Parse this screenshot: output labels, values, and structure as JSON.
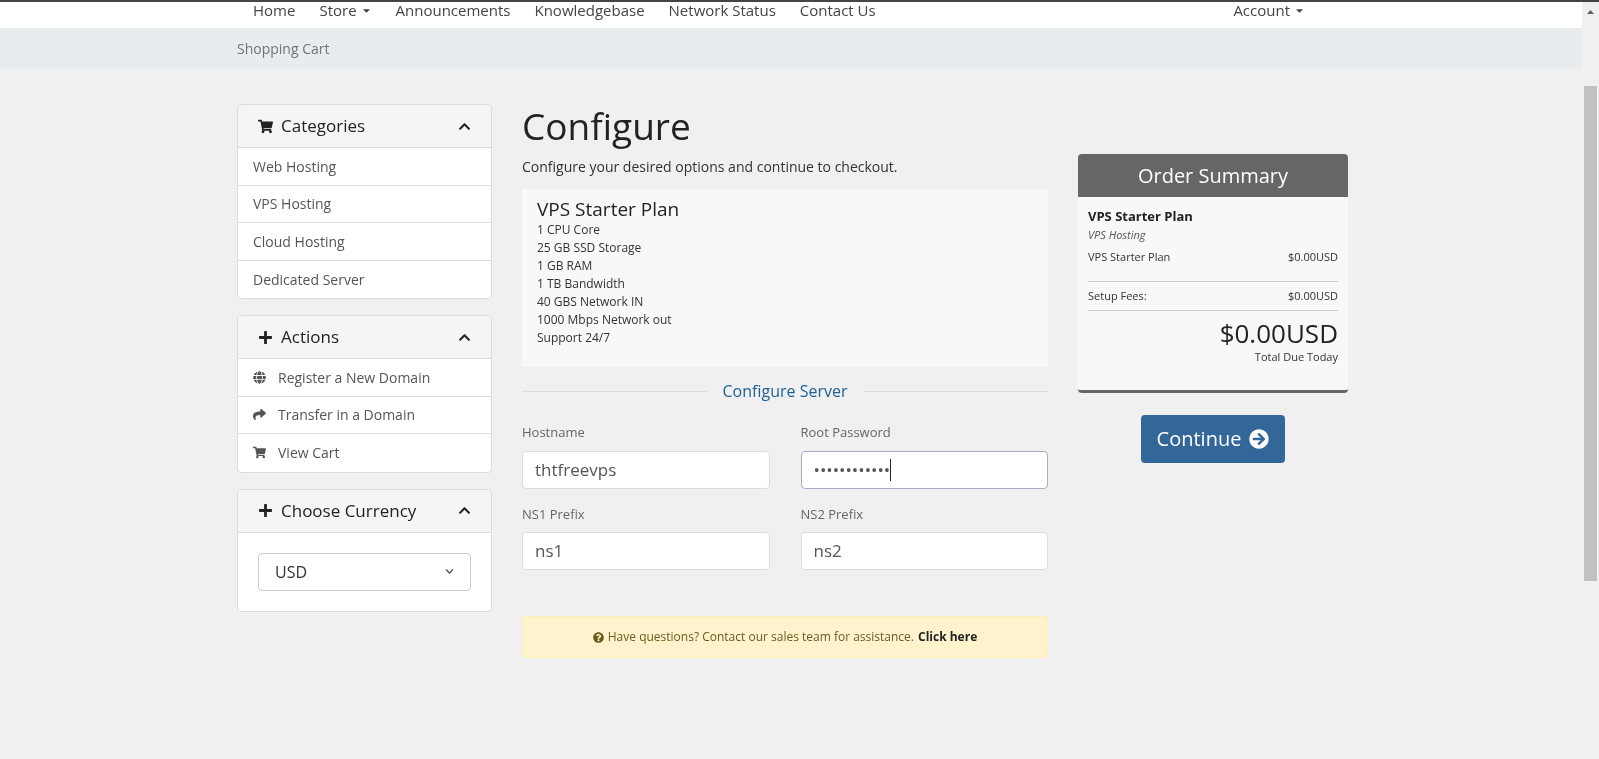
{
  "navbar": {
    "items": [
      {
        "label": "Home",
        "dropdown": false
      },
      {
        "label": "Store",
        "dropdown": true
      },
      {
        "label": "Announcements",
        "dropdown": false
      },
      {
        "label": "Knowledgebase",
        "dropdown": false
      },
      {
        "label": "Network Status",
        "dropdown": false
      },
      {
        "label": "Contact Us",
        "dropdown": false
      }
    ],
    "account": {
      "label": "Account",
      "dropdown": true
    }
  },
  "breadcrumb": "Shopping Cart",
  "sidebar": [
    {
      "title": "Categories",
      "expanded": true,
      "kind": "links",
      "items": [
        {
          "label": "Web Hosting",
          "kind": "plain"
        },
        {
          "label": "VPS Hosting",
          "kind": "plain"
        },
        {
          "label": "Cloud Hosting",
          "kind": "plain"
        },
        {
          "label": "Dedicated Server",
          "kind": "plain"
        }
      ]
    },
    {
      "title": "Actions",
      "expanded": true,
      "kind": "links",
      "items": [
        {
          "label": "Register a New Domain",
          "kind": "domain"
        },
        {
          "label": "Transfer in a Domain",
          "kind": "transfer"
        },
        {
          "label": "View Cart",
          "kind": "cart"
        }
      ]
    },
    {
      "title": "Choose Currency",
      "expanded": true,
      "kind": "select",
      "value": "USD"
    }
  ],
  "main": {
    "title": "Configure",
    "subtitle": "Configure your desired options and continue to checkout.",
    "product": {
      "name": "VPS Starter Plan",
      "features": [
        "1 CPU Core",
        "25 GB SSD Storage",
        "1 GB RAM",
        "1 TB Bandwidth",
        "40 GBS Network IN",
        "1000 Mbps Network out",
        "Support 24/7"
      ]
    },
    "section_title": "Configure Server",
    "fields": [
      {
        "label": "Hostname",
        "value": "thtfreevps",
        "focused": false
      },
      {
        "label": "Root Password",
        "value": "••••••••••••",
        "focused": true
      },
      {
        "label": "NS1 Prefix",
        "value": "ns1",
        "focused": false
      },
      {
        "label": "NS2 Prefix",
        "value": "ns2",
        "focused": false
      }
    ],
    "help": {
      "text": "Have questions? Contact our sales team for assistance.",
      "link": "Click here"
    }
  },
  "summary": {
    "title": "Order Summary",
    "product": "VPS Starter Plan",
    "group": "VPS Hosting",
    "lines": [
      {
        "label": "VPS Starter Plan",
        "amount": "$0.00USD"
      },
      {
        "label": "Setup Fees:",
        "amount": "$0.00USD"
      }
    ],
    "total": "$0.00USD",
    "total_label": "Total Due Today",
    "button": "Continue"
  }
}
